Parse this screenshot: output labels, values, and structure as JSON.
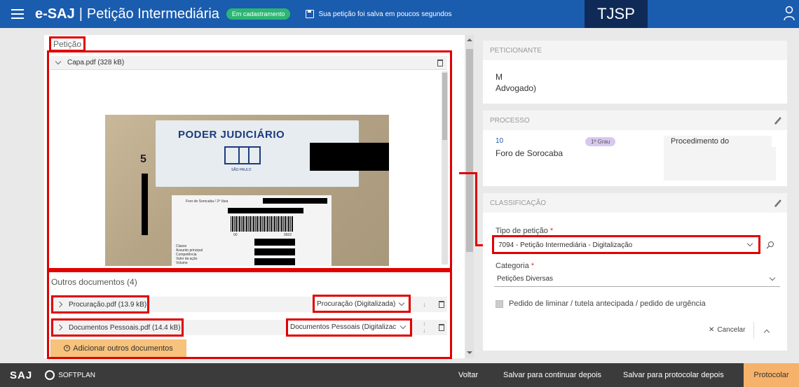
{
  "header": {
    "brand": "e-SAJ",
    "separator": "|",
    "page_title": "Petição Intermediária",
    "status_badge": "Em cadastramento",
    "saved_note": "Sua petição foi salva em poucos segundos",
    "court": "TJSP"
  },
  "left": {
    "section_label": "Petição",
    "main_doc": {
      "name": "Capa.pdf (328 kB)"
    },
    "preview": {
      "heading": "PODER JUDICIÁRIO",
      "seal_caption": "SÃO PAULO",
      "number": "5",
      "foro_label": "Foro de Sorocaba / 2ª Vara",
      "barcode_digits_a": "00",
      "barcode_digits_b": "0602",
      "fields": [
        "Classe",
        "Assunto principal",
        "Competência",
        "Valor da ação",
        "Volume"
      ]
    },
    "outros": {
      "title": "Outros documentos (4)",
      "items": [
        {
          "name": "Procuração.pdf (13.9 kB)",
          "type": "Procuração (Digitalizada)"
        },
        {
          "name": "Documentos Pessoais.pdf (14.4 kB)",
          "type": "Documentos Pessoais (Digitalizac"
        }
      ],
      "add_label": "Adicionar outros documentos"
    }
  },
  "right": {
    "peticionante": {
      "head": "PETICIONANTE",
      "name": "M",
      "role": "Advogado)"
    },
    "processo": {
      "head": "PROCESSO",
      "number": "10",
      "grau": "1º Grau",
      "foro": "Foro de Sorocaba",
      "procedimento": "Procedimento do"
    },
    "classificacao": {
      "head": "CLASSIFICAÇÃO",
      "tipo_label": "Tipo de petição",
      "tipo_value": "7094 - Petição Intermediária - Digitalização",
      "categoria_label": "Categoria",
      "categoria_value": "Petições Diversas",
      "checkbox_label": "Pedido de liminar / tutela antecipada / pedido de urgência",
      "cancel_label": "Cancelar",
      "required_mark": "*"
    }
  },
  "footer": {
    "logo": "SAJ",
    "softplan": "SOFTPLAN",
    "voltar": "Voltar",
    "salvar_continuar": "Salvar para continuar depois",
    "salvar_protocolar": "Salvar para protocolar depois",
    "protocolar": "Protocolar"
  },
  "colors": {
    "header": "#1a5cae",
    "court": "#0f2a57",
    "badge": "#2bb673",
    "highlight": "#e00000",
    "accent": "#f6b26b"
  }
}
